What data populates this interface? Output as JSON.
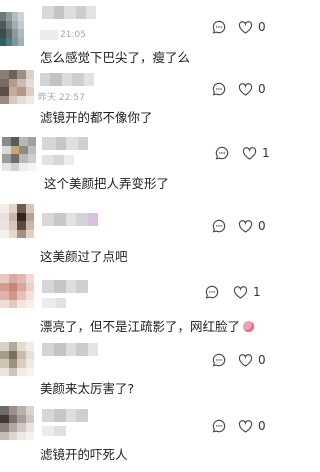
{
  "comments": [
    {
      "meta": "21:05",
      "text": "怎么感觉下巴尖了，瘦了么",
      "likes": "0"
    },
    {
      "meta": "昨天 22:57",
      "text": "滤镜开的都不像你了",
      "likes": "0"
    },
    {
      "meta": "",
      "text": "这个美颜把人弄变形了",
      "likes": "1"
    },
    {
      "meta": "",
      "text": "这美颜过了点吧",
      "likes": "0"
    },
    {
      "meta": "",
      "text": "漂亮了，但不是江疏影了，网红脸了",
      "likes": "1"
    },
    {
      "meta": "",
      "text": "美颜来太厉害了?",
      "likes": "0"
    },
    {
      "meta": "",
      "text": "滤镜开的吓死人",
      "likes": "0"
    }
  ],
  "icons": {
    "reply": "comment-bubble-icon",
    "like": "heart-icon",
    "emoji": "peach-emoji-icon"
  },
  "colors": {
    "text": "#1f1f1f",
    "meta": "#a9a9a9",
    "icon": "#444444"
  }
}
